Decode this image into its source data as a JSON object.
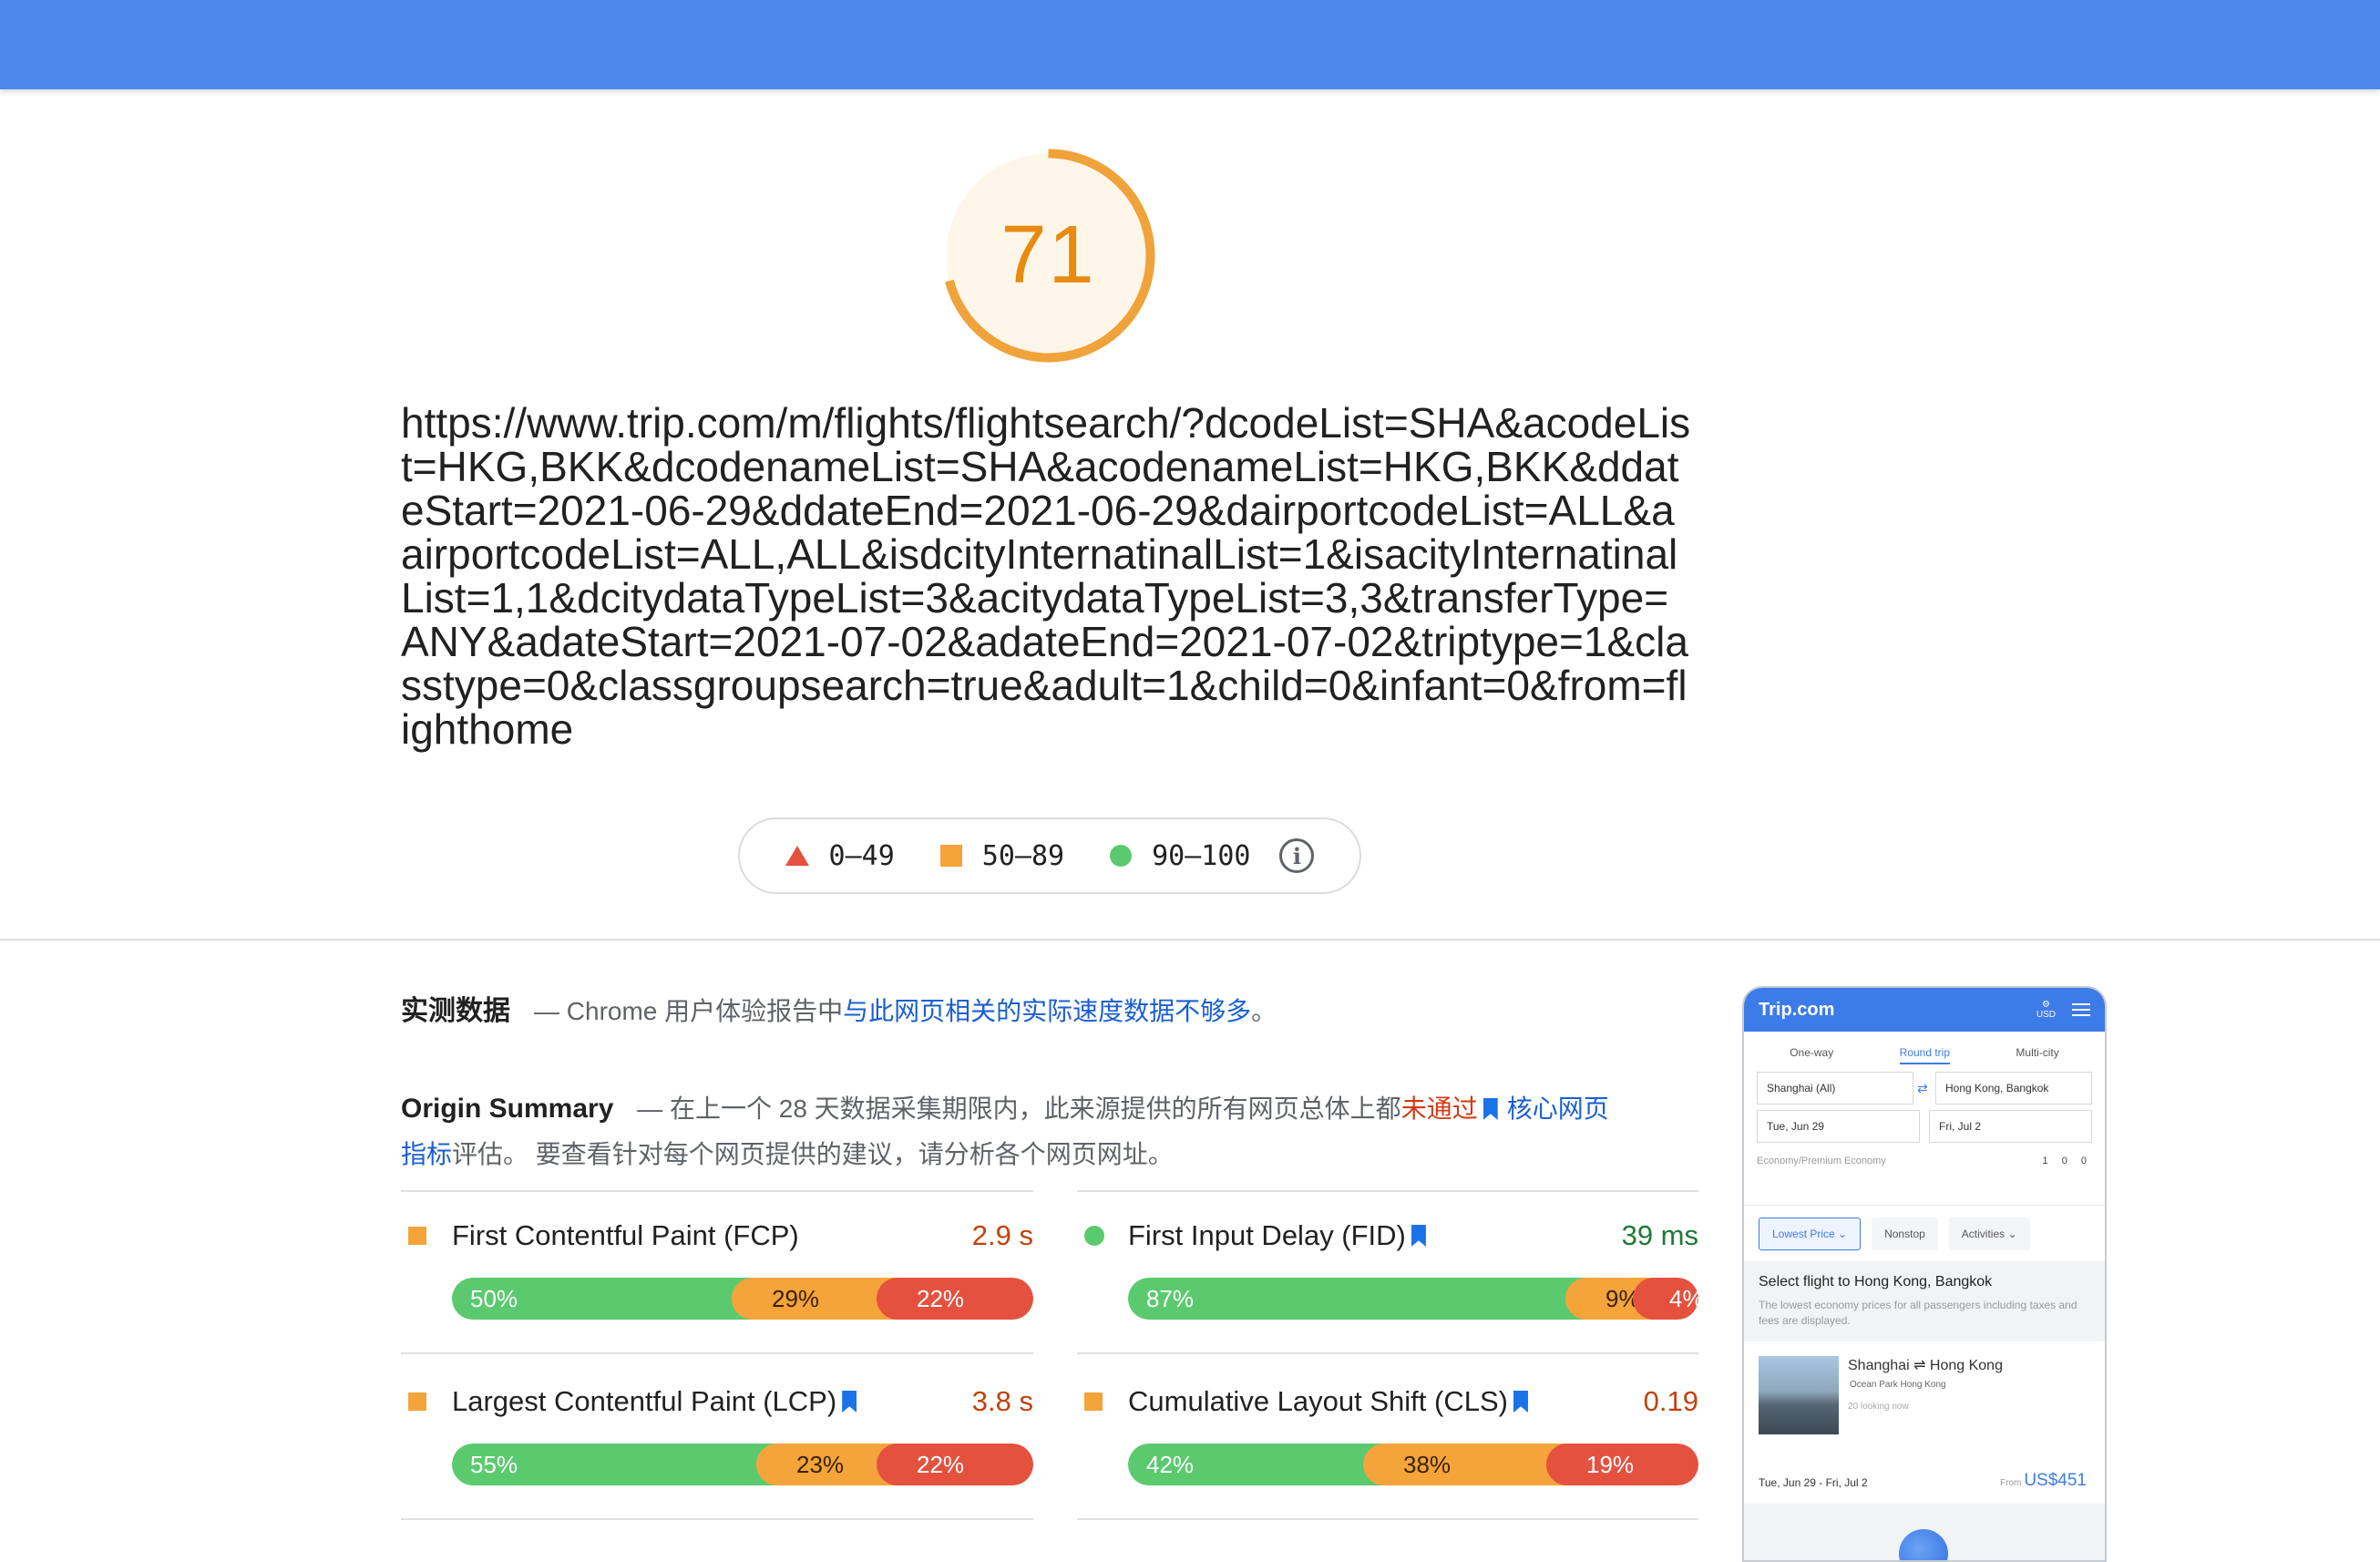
{
  "score": "71",
  "gauge_fraction": 0.71,
  "url": "https://www.trip.com/m/flights/flightsearch/?dcodeList=SHA&acodeList=HKG,BKK&dcodenameList=SHA&acodenameList=HKG,BKK&ddateStart=2021-06-29&ddateEnd=2021-06-29&dairportcodeList=ALL&aairportcodeList=ALL,ALL&isdcityInternatinalList=1&isacityInternatinalList=1,1&dcitydataTypeList=3&acitydataTypeList=3,3&transferType=ANY&adateStart=2021-07-02&adateEnd=2021-07-02&triptype=1&classtype=0&classgroupsearch=true&adult=1&child=0&infant=0&from=flighthome",
  "legend": {
    "poor": "0–49",
    "average": "50–89",
    "good": "90–100"
  },
  "colors": {
    "good": "#5bca6f",
    "average": "#f4a43a",
    "poor": "#e5513f",
    "link": "#1a5fd1",
    "header": "#4e87ec"
  },
  "field": {
    "title": "实测数据",
    "prefix": "— Chrome 用户体验报告中",
    "link": "与此网页相关的实际速度数据不够多",
    "suffix": "。"
  },
  "origin": {
    "title": "Origin Summary",
    "text1": "— 在上一个 28 天数据采集期限内，此来源提供的所有网页总体上都",
    "fail": "未通过",
    "link": "核心网页指标",
    "text2": "评估。 要查看针对每个网页提供的建议，请分析各个网页网址。"
  },
  "metrics": {
    "fcp": {
      "name": "First Contentful Paint (FCP)",
      "value": "2.9 s",
      "good": "50%",
      "avg": "29%",
      "poor": "22%"
    },
    "fid": {
      "name": "First Input Delay (FID)",
      "value": "39 ms",
      "good": "87%",
      "avg": "9%",
      "poor": "4%"
    },
    "lcp": {
      "name": "Largest Contentful Paint (LCP)",
      "value": "3.8 s",
      "good": "55%",
      "avg": "23%",
      "poor": "22%"
    },
    "cls": {
      "name": "Cumulative Layout Shift (CLS)",
      "value": "0.19",
      "good": "42%",
      "avg": "38%",
      "poor": "19%"
    }
  },
  "phone": {
    "logo": "Trip.com",
    "currency": "USD",
    "tabs": [
      "One-way",
      "Round trip",
      "Multi-city"
    ],
    "from": "Shanghai (All)",
    "to": "Hong Kong, Bangkok",
    "depart": "Tue, Jun 29",
    "return": "Fri, Jul 2",
    "cabin": "Economy/Premium Economy",
    "pax": "1 0 0",
    "filters": [
      "Lowest Price",
      "Nonstop",
      "Activities"
    ],
    "select_title": "Select flight to Hong Kong, Bangkok",
    "select_sub": "The lowest economy prices for all passengers including taxes and fees are displayed.",
    "card_title": "Shanghai ⇌ Hong Kong",
    "card_sub": "Ocean Park Hong Kong",
    "card_looking": "20 looking now",
    "card_dates": "Tue, Jun 29 - Fri, Jul 2",
    "card_from": "From",
    "card_price": "US$451"
  }
}
